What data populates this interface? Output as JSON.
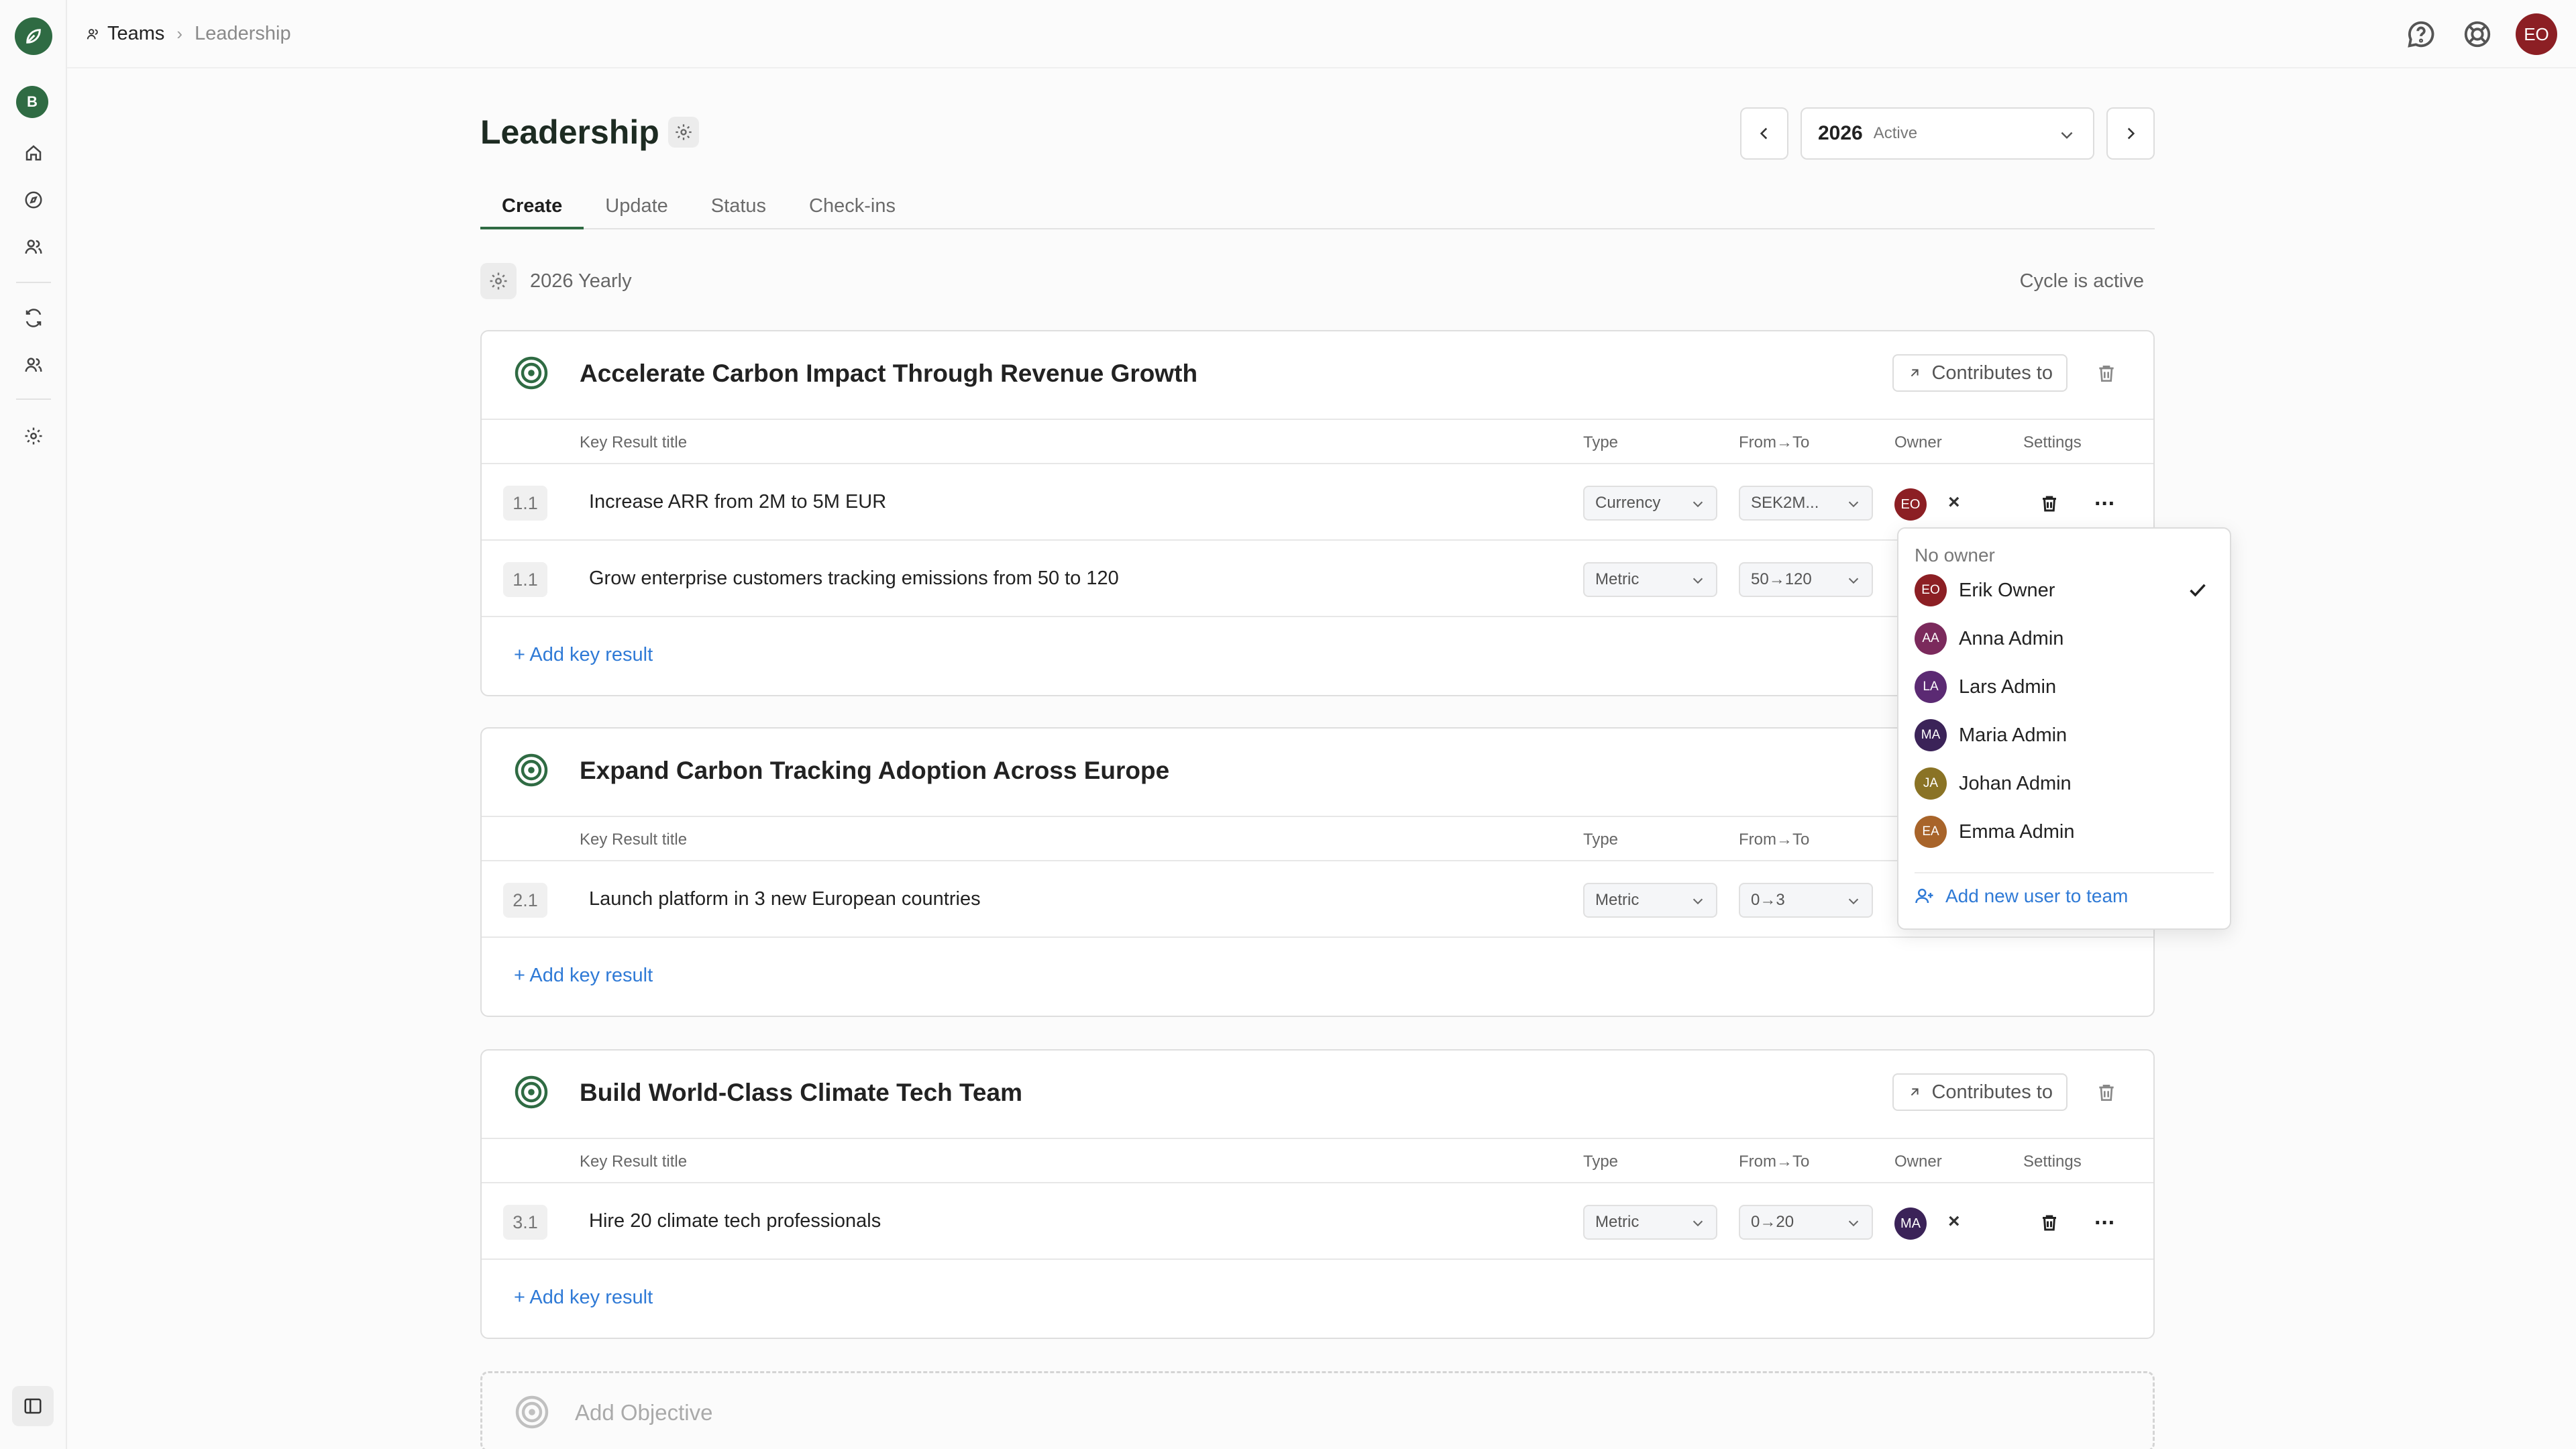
{
  "breadcrumb": {
    "teams": "Teams",
    "current": "Leadership"
  },
  "user": {
    "initials": "EO",
    "color": "#8c1f24"
  },
  "org": {
    "initial": "B"
  },
  "page": {
    "title": "Leadership"
  },
  "cycle_selector": {
    "year": "2026",
    "status": "Active"
  },
  "tabs": [
    {
      "label": "Create",
      "active": true
    },
    {
      "label": "Update",
      "active": false
    },
    {
      "label": "Status",
      "active": false
    },
    {
      "label": "Check-ins",
      "active": false
    }
  ],
  "cycle": {
    "name": "2026 Yearly",
    "state": "Cycle is active"
  },
  "table_headers": {
    "title": "Key Result title",
    "type": "Type",
    "from_to": "From→To",
    "owner": "Owner",
    "settings": "Settings"
  },
  "contributes_label": "Contributes to",
  "add_key_result": "+ Add key result",
  "objectives": [
    {
      "title": "Accelerate Carbon Impact Through Revenue Growth",
      "key_results": [
        {
          "num": "1.1",
          "title": "Increase ARR from 2M to 5M EUR",
          "type": "Currency",
          "range": "SEK2M...",
          "owner": "EO",
          "owner_color": "#8c1f24"
        },
        {
          "num": "1.1",
          "title": "Grow enterprise customers tracking emissions from 50 to 120",
          "type": "Metric",
          "range": "50→120"
        }
      ]
    },
    {
      "title": "Expand Carbon Tracking Adoption Across Europe",
      "key_results": [
        {
          "num": "2.1",
          "title": "Launch platform in 3 new European countries",
          "type": "Metric",
          "range": "0→3"
        }
      ]
    },
    {
      "title": "Build World-Class Climate Tech Team",
      "key_results": [
        {
          "num": "3.1",
          "title": "Hire 20 climate tech professionals",
          "type": "Metric",
          "range": "0→20",
          "owner": "MA",
          "owner_color": "#3b2358"
        }
      ]
    }
  ],
  "add_objective": "Add Objective",
  "owner_dropdown": {
    "no_owner": "No owner",
    "options": [
      {
        "initials": "EO",
        "name": "Erik Owner",
        "color": "#8c1f24",
        "selected": true
      },
      {
        "initials": "AA",
        "name": "Anna Admin",
        "color": "#7b2a5c"
      },
      {
        "initials": "LA",
        "name": "Lars Admin",
        "color": "#5b2a73"
      },
      {
        "initials": "MA",
        "name": "Maria Admin",
        "color": "#3b2358"
      },
      {
        "initials": "JA",
        "name": "Johan Admin",
        "color": "#8a7325"
      },
      {
        "initials": "EA",
        "name": "Emma Admin",
        "color": "#a8642a"
      }
    ],
    "add_user": "Add new user to team"
  },
  "icons": {
    "logo": "leaf-logo-icon",
    "help": "help-icon",
    "support": "lifebuoy-icon",
    "target": "target-icon",
    "trash": "trash-icon"
  },
  "colors": {
    "brand": "#2f6b43",
    "link": "#2f7ad6"
  }
}
